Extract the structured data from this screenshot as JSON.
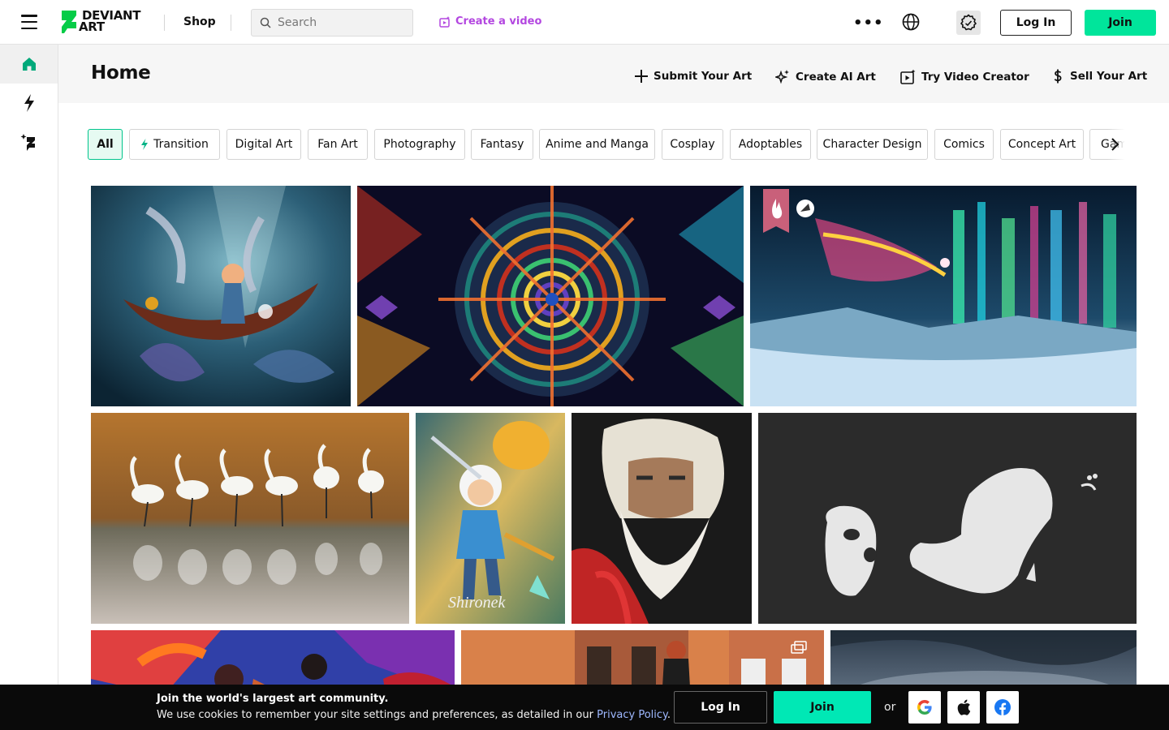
{
  "topbar": {
    "logo_text_line1": "DEVIANT",
    "logo_text_line2": "ART",
    "shop_label": "Shop",
    "search_placeholder": "Search",
    "create_video_label": "Create a video",
    "more_label": "•••",
    "login_label": "Log In",
    "join_label": "Join"
  },
  "sidebar": {
    "items": [
      {
        "name": "home",
        "icon": "home-icon"
      },
      {
        "name": "watch-feed",
        "icon": "lightning-icon"
      },
      {
        "name": "ai",
        "icon": "sparkle-logo-icon"
      }
    ]
  },
  "header": {
    "title": "Home",
    "actions": [
      {
        "label": "Submit Your Art",
        "icon": "plus-icon"
      },
      {
        "label": "Create AI Art",
        "icon": "sparkle-icon"
      },
      {
        "label": "Try Video Creator",
        "icon": "video-icon"
      },
      {
        "label": "Sell Your Art",
        "icon": "dollar-icon"
      }
    ]
  },
  "tags": [
    {
      "label": "All",
      "active": true
    },
    {
      "label": "Transition",
      "icon": "lightning-icon"
    },
    {
      "label": "Digital Art"
    },
    {
      "label": "Fan Art"
    },
    {
      "label": "Photography"
    },
    {
      "label": "Fantasy"
    },
    {
      "label": "Anime and Manga"
    },
    {
      "label": "Cosplay"
    },
    {
      "label": "Adoptables"
    },
    {
      "label": "Character Design"
    },
    {
      "label": "Comics"
    },
    {
      "label": "Concept Art"
    },
    {
      "label": "Game Art"
    }
  ],
  "colors": {
    "accent": "#00e59b",
    "ai_purple": "#b347e0",
    "cookie_join": "#00e8b5",
    "link_blue": "#9eb8ff",
    "badge_pink": "#c9607a"
  },
  "cookie": {
    "title": "Join the world's largest art community.",
    "text": "We use cookies to remember your site settings and preferences, as detailed in our",
    "link": "Privacy Policy",
    "period": ".",
    "login_label": "Log In",
    "join_label": "Join",
    "or_label": "or"
  }
}
